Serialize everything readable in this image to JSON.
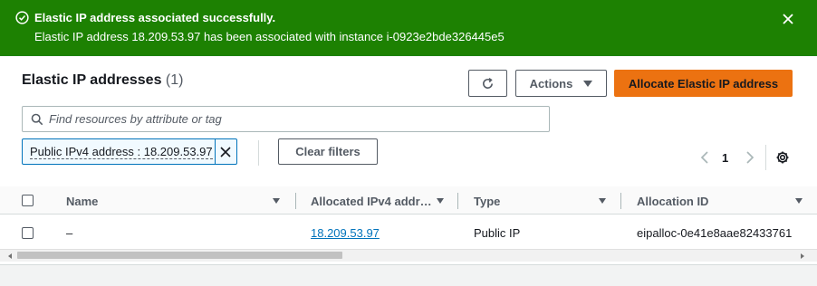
{
  "flash": {
    "title": "Elastic IP address associated successfully.",
    "message": "Elastic IP address 18.209.53.97 has been associated with instance i-0923e2bde326445e5",
    "background": "#1d8102",
    "icon": "check-circle-icon",
    "close_icon": "close-icon"
  },
  "panel": {
    "title": "Elastic IP addresses",
    "count": "(1)",
    "refresh_icon": "refresh-icon",
    "actions_label": "Actions",
    "allocate_label": "Allocate Elastic IP address",
    "accent": "#ec7211"
  },
  "search": {
    "placeholder": "Find resources by attribute or tag",
    "value": ""
  },
  "filter": {
    "token_label": "Public IPv4 address : 18.209.53.97",
    "clear_label": "Clear filters"
  },
  "pagination": {
    "current_page": "1"
  },
  "table": {
    "columns": [
      "Name",
      "Allocated IPv4 addr…",
      "Type",
      "Allocation ID"
    ],
    "rows": [
      {
        "name": "–",
        "ip": "18.209.53.97",
        "type": "Public IP",
        "allocation_id": "eipalloc-0e41e8aae82433761"
      }
    ],
    "link_color": "#0073bb"
  }
}
